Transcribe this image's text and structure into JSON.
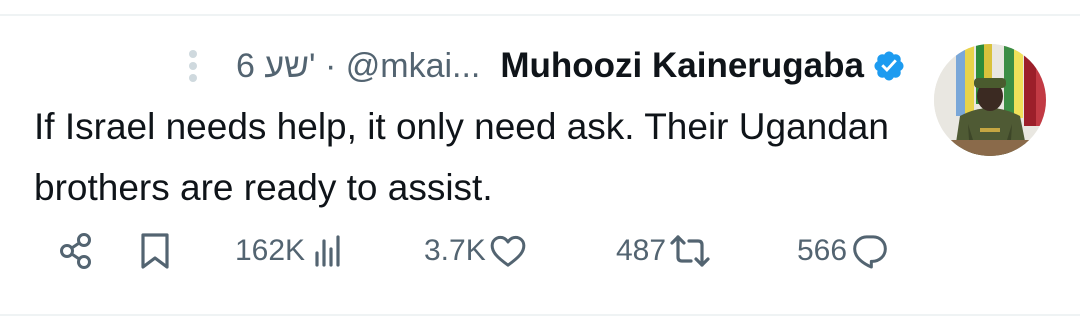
{
  "tweet": {
    "author": {
      "display_name": "Muhoozi Kainerugaba",
      "handle": "@mkai...",
      "verified": true
    },
    "separator": "·",
    "time_ago": "6 שע'",
    "text": "If Israel needs help, it only need ask. Their Ugandan brothers are ready to assist."
  },
  "actions": {
    "share": {
      "icon": "share-icon"
    },
    "bookmark": {
      "icon": "bookmark-icon"
    },
    "views": {
      "icon": "views-icon",
      "count": "162K"
    },
    "likes": {
      "icon": "heart-icon",
      "count": "3.7K"
    },
    "retweets": {
      "icon": "retweet-icon",
      "count": "487"
    },
    "replies": {
      "icon": "reply-icon",
      "count": "566"
    }
  },
  "colors": {
    "text": "#0f1419",
    "secondary": "#536471",
    "verified": "#1d9bf0",
    "divider": "#eff3f4"
  }
}
